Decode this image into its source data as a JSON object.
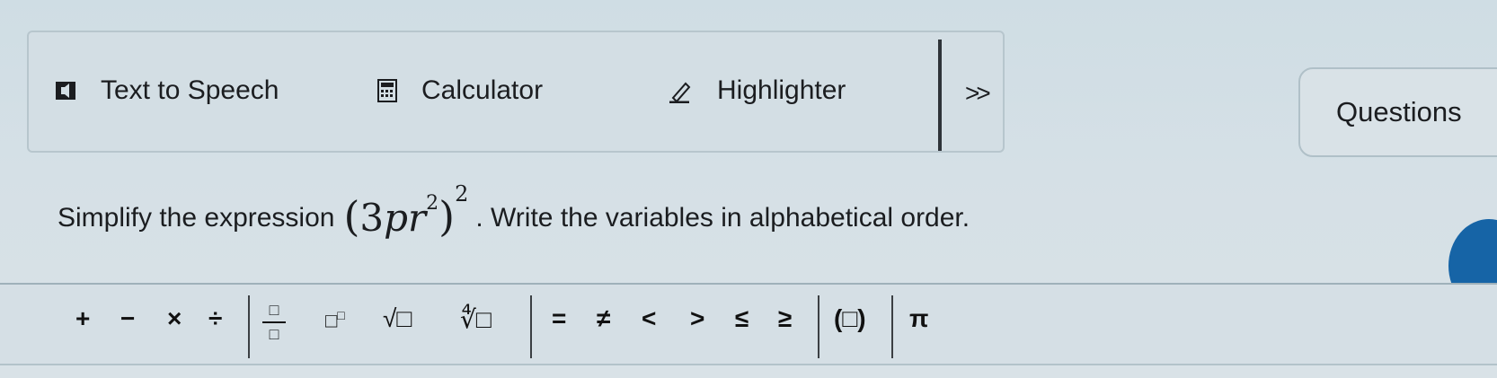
{
  "toolbar": {
    "tts_label": "Text to Speech",
    "calculator_label": "Calculator",
    "highlighter_label": "Highlighter",
    "more_label": ">>"
  },
  "questions_label": "Questions",
  "question": {
    "prefix": "Simplify the expression",
    "math": {
      "open": "(",
      "coef": "3",
      "var1": "p",
      "var2": "r",
      "inner_exp": "2",
      "close": ")",
      "outer_exp": "2"
    },
    "suffix": ". Write the variables in alphabetical order."
  },
  "math_keys": {
    "plus": "+",
    "minus": "−",
    "times": "×",
    "divide": "÷",
    "fraction_box": "□",
    "power_base": "□",
    "power_exp": "□",
    "sqrt": "√□",
    "nth_root": "∜□",
    "equal": "=",
    "not_equal": "≠",
    "less": "<",
    "greater": ">",
    "leq": "≤",
    "geq": "≥",
    "parens": "(□)",
    "pi": "π"
  },
  "colors": {
    "accent": "#1664a6",
    "background": "#d5e0e6"
  }
}
